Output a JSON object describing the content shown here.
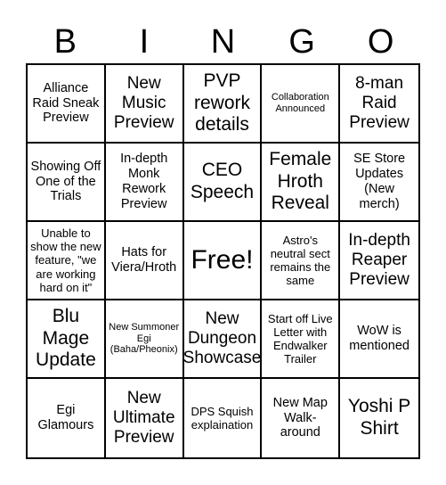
{
  "header": {
    "letters": [
      "B",
      "I",
      "N",
      "G",
      "O"
    ]
  },
  "board": {
    "rows": [
      [
        {
          "text": "Alliance Raid Sneak Preview"
        },
        {
          "text": "New Music Preview"
        },
        {
          "text": "PVP rework details"
        },
        {
          "text": "Collaboration Announced"
        },
        {
          "text": "8-man Raid Preview"
        }
      ],
      [
        {
          "text": "Showing Off One of the Trials"
        },
        {
          "text": "In-depth Monk Rework Preview"
        },
        {
          "text": "CEO Speech"
        },
        {
          "text": "Female Hroth Reveal"
        },
        {
          "text": "SE Store Updates (New merch)"
        }
      ],
      [
        {
          "text": "Unable to show the new feature, \"we are working hard on it\""
        },
        {
          "text": "Hats for Viera/Hroth"
        },
        {
          "text": "Free!"
        },
        {
          "text": "Astro's neutral sect remains the same"
        },
        {
          "text": "In-depth Reaper Preview"
        }
      ],
      [
        {
          "text": "Blu Mage Update"
        },
        {
          "text": "New Summoner Egi (Baha/Pheonix)"
        },
        {
          "text": "New Dungeon Showcase"
        },
        {
          "text": "Start off Live Letter with Endwalker Trailer"
        },
        {
          "text": "WoW is mentioned"
        }
      ],
      [
        {
          "text": "Egi Glamours"
        },
        {
          "text": "New Ultimate Preview"
        },
        {
          "text": "DPS Squish explaination"
        },
        {
          "text": "New Map Walk-around"
        },
        {
          "text": "Yoshi P Shirt"
        }
      ]
    ]
  }
}
